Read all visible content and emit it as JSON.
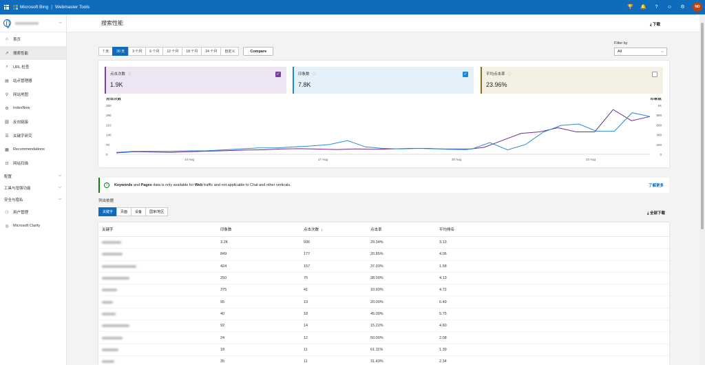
{
  "topbar": {
    "brand": "Microsoft Bing",
    "product": "Webmaster Tools",
    "avatar_initials": "ND",
    "colors": {
      "bar": "#0f6cbd",
      "avatar": "#c2410c"
    },
    "icons": [
      "rewards-icon",
      "bell-icon",
      "help-icon",
      "smiley-icon",
      "settings-icon"
    ]
  },
  "sidebar": {
    "items": [
      {
        "label": "首页",
        "icon": "home-icon"
      },
      {
        "label": "搜索性能",
        "icon": "trend-icon",
        "active": true
      },
      {
        "label": "URL 检查",
        "icon": "search-icon"
      },
      {
        "label": "站点管理器",
        "icon": "document-icon"
      },
      {
        "label": "网站地图",
        "icon": "sitemap-icon"
      },
      {
        "label": "IndexNow",
        "icon": "gear-icon"
      },
      {
        "label": "反向链接",
        "icon": "link-icon"
      },
      {
        "label": "关键字研究",
        "icon": "list-icon"
      },
      {
        "label": "Recommendations",
        "icon": "clipboard-icon"
      },
      {
        "label": "网站扫描",
        "icon": "scan-icon"
      }
    ],
    "groups": [
      {
        "label": "配置"
      },
      {
        "label": "工具与增强功能"
      },
      {
        "label": "安全与隐私"
      }
    ],
    "bottom": [
      {
        "label": "用户管理",
        "icon": "users-icon"
      },
      {
        "label": "Microsoft Clarity",
        "icon": "clarity-icon"
      }
    ]
  },
  "page": {
    "title": "搜索性能",
    "download": "下载"
  },
  "date_tabs": [
    "7 天",
    "30 天",
    "3 个月",
    "6 个月",
    "12 个月",
    "18 个月",
    "24 个月",
    "自定义"
  ],
  "date_selected": "30 天",
  "compare_label": "Compare",
  "filter": {
    "label": "Filter by",
    "value": "All"
  },
  "metrics": [
    {
      "label": "点击次数",
      "value": "1.9K",
      "checked": true,
      "color": "#7b3fa0",
      "bg": "#efe6f5"
    },
    {
      "label": "印象数",
      "value": "7.8K",
      "checked": true,
      "color": "#1e88d6",
      "bg": "#e4f0fa"
    },
    {
      "label": "平均点击率",
      "value": "23.96%",
      "checked": false,
      "color": "#8a6d1b",
      "bg": "#f4f0e4"
    }
  ],
  "chart_data": {
    "type": "line",
    "left_label": "点击次数",
    "right_label": "印象数",
    "left_ticks": [
      "0",
      "70",
      "140",
      "210",
      "280",
      "350"
    ],
    "right_ticks": [
      "0",
      "200",
      "400",
      "600",
      "800",
      "1K"
    ],
    "x_ticks": [
      "14 Aug",
      "17 Aug",
      "20 Aug",
      "23 Aug"
    ],
    "ylim_left": [
      0,
      350
    ],
    "ylim_right": [
      0,
      1000
    ],
    "series": [
      {
        "name": "点击次数",
        "axis": "left",
        "color": "#6b2d8f",
        "values": [
          10,
          18,
          16,
          14,
          18,
          22,
          26,
          30,
          32,
          38,
          40,
          37,
          34,
          38,
          36,
          38,
          42,
          42,
          36,
          34,
          50,
          100,
          150,
          160,
          190,
          160,
          160,
          320,
          240,
          270
        ]
      },
      {
        "name": "印象数",
        "axis": "right",
        "color": "#2a8ad4",
        "values": [
          40,
          60,
          60,
          60,
          70,
          70,
          90,
          110,
          130,
          130,
          150,
          170,
          200,
          280,
          150,
          120,
          110,
          120,
          110,
          110,
          110,
          240,
          90,
          200,
          450,
          590,
          620,
          470,
          470,
          850,
          770
        ]
      }
    ]
  },
  "notice": {
    "text_parts": [
      {
        "t": "Keywords",
        "b": true
      },
      {
        "t": " and ",
        "b": false
      },
      {
        "t": "Pages",
        "b": true
      },
      {
        "t": " data is only available for ",
        "b": false
      },
      {
        "t": "Web",
        "b": true
      },
      {
        "t": " traffic and not applicable to Chat and other verticals.",
        "b": false
      }
    ],
    "link": "了解更多"
  },
  "grouping": {
    "label": "列出依据",
    "tabs": [
      "关键字",
      "页面",
      "设备",
      "国家/地区"
    ],
    "selected": "关键字",
    "download_all": "全部下载"
  },
  "table": {
    "columns": [
      "关键字",
      "印象数",
      "点击次数",
      "点击率",
      "平均排名"
    ],
    "sort_icon": "↓",
    "rows": [
      {
        "kw_w": 28,
        "impr": "3.2K",
        "clicks": "936",
        "ctr": "29.34%",
        "pos": "3.13"
      },
      {
        "kw_w": 30,
        "impr": "849",
        "clicks": "177",
        "ctr": "20.85%",
        "pos": "4.06"
      },
      {
        "kw_w": 50,
        "impr": "424",
        "clicks": "157",
        "ctr": "37.03%",
        "pos": "1.58"
      },
      {
        "kw_w": 40,
        "impr": "250",
        "clicks": "70",
        "ctr": "28.00%",
        "pos": "4.13"
      },
      {
        "kw_w": 22,
        "impr": "375",
        "clicks": "41",
        "ctr": "10.93%",
        "pos": "4.72"
      },
      {
        "kw_w": 16,
        "impr": "95",
        "clicks": "19",
        "ctr": "20.00%",
        "pos": "6.49"
      },
      {
        "kw_w": 20,
        "impr": "40",
        "clicks": "18",
        "ctr": "45.00%",
        "pos": "5.75"
      },
      {
        "kw_w": 40,
        "impr": "92",
        "clicks": "14",
        "ctr": "15.22%",
        "pos": "4.60"
      },
      {
        "kw_w": 30,
        "impr": "24",
        "clicks": "12",
        "ctr": "50.00%",
        "pos": "2.08"
      },
      {
        "kw_w": 24,
        "impr": "18",
        "clicks": "11",
        "ctr": "61.11%",
        "pos": "1.39"
      },
      {
        "kw_w": 18,
        "impr": "35",
        "clicks": "11",
        "ctr": "31.43%",
        "pos": "2.34"
      }
    ]
  }
}
